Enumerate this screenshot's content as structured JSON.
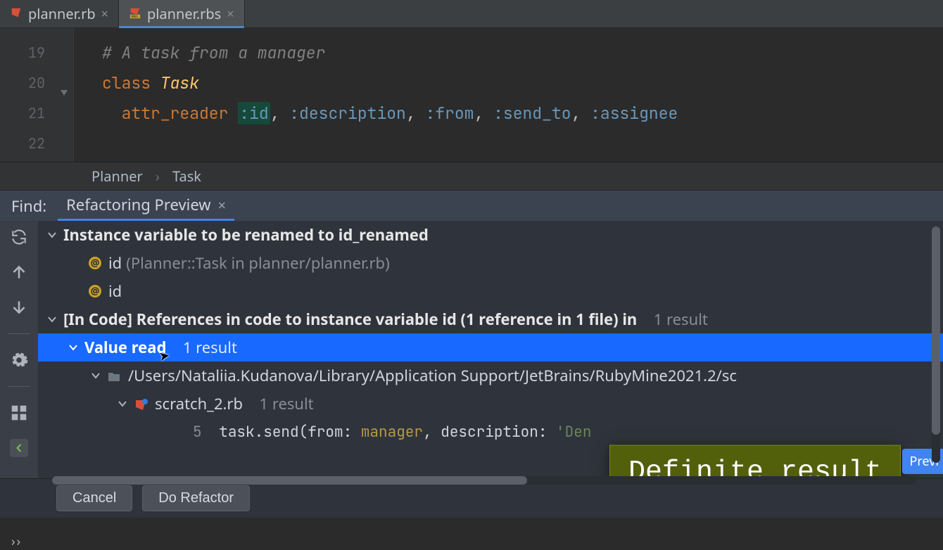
{
  "tabs": [
    {
      "label": "planner.rb",
      "icon": "ruby-file-icon",
      "active": false
    },
    {
      "label": "planner.rbs",
      "icon": "rbs-file-icon",
      "active": true
    }
  ],
  "editor": {
    "lines": [
      "19",
      "20",
      "21",
      "22"
    ],
    "comment": "# A task from a manager",
    "class_kw": "class",
    "class_name": "Task",
    "attr_kw": "attr_reader",
    "symbol_hl": ":id",
    "symbols_rest": [
      ", ",
      ":description",
      ", ",
      ":from",
      ", ",
      ":send_to",
      ", ",
      ":assignee"
    ]
  },
  "breadcrumb": [
    "Planner",
    "Task"
  ],
  "find": {
    "label": "Find:",
    "tab": "Refactoring Preview"
  },
  "tree": {
    "heading": "Instance variable to be renamed to id_renamed",
    "var_items": [
      {
        "name": "id",
        "detail": "(Planner::Task in planner/planner.rb)"
      },
      {
        "name": "id",
        "detail": ""
      }
    ],
    "section2": {
      "prefix": "[In Code] References in code to instance variable id (1 reference in 1 file) in",
      "suffix": "1 result"
    },
    "valueRead": {
      "label": "Value read",
      "count": "1 result"
    },
    "path": "/Users/Nataliia.Kudanova/Library/Application Support/JetBrains/RubyMine2021.2/sc",
    "file": {
      "name": "scratch_2.rb",
      "count": "1 result"
    },
    "usage": {
      "lineNo": "5",
      "code_plain1": "task.send(from: ",
      "code_id1": "manager",
      "code_plain2": ", description: ",
      "code_str": "'Den",
      "trailingBadge": "Previ"
    }
  },
  "tooltip": "Definite result",
  "buttons": {
    "cancel": "Cancel",
    "refactor": "Do Refactor"
  }
}
